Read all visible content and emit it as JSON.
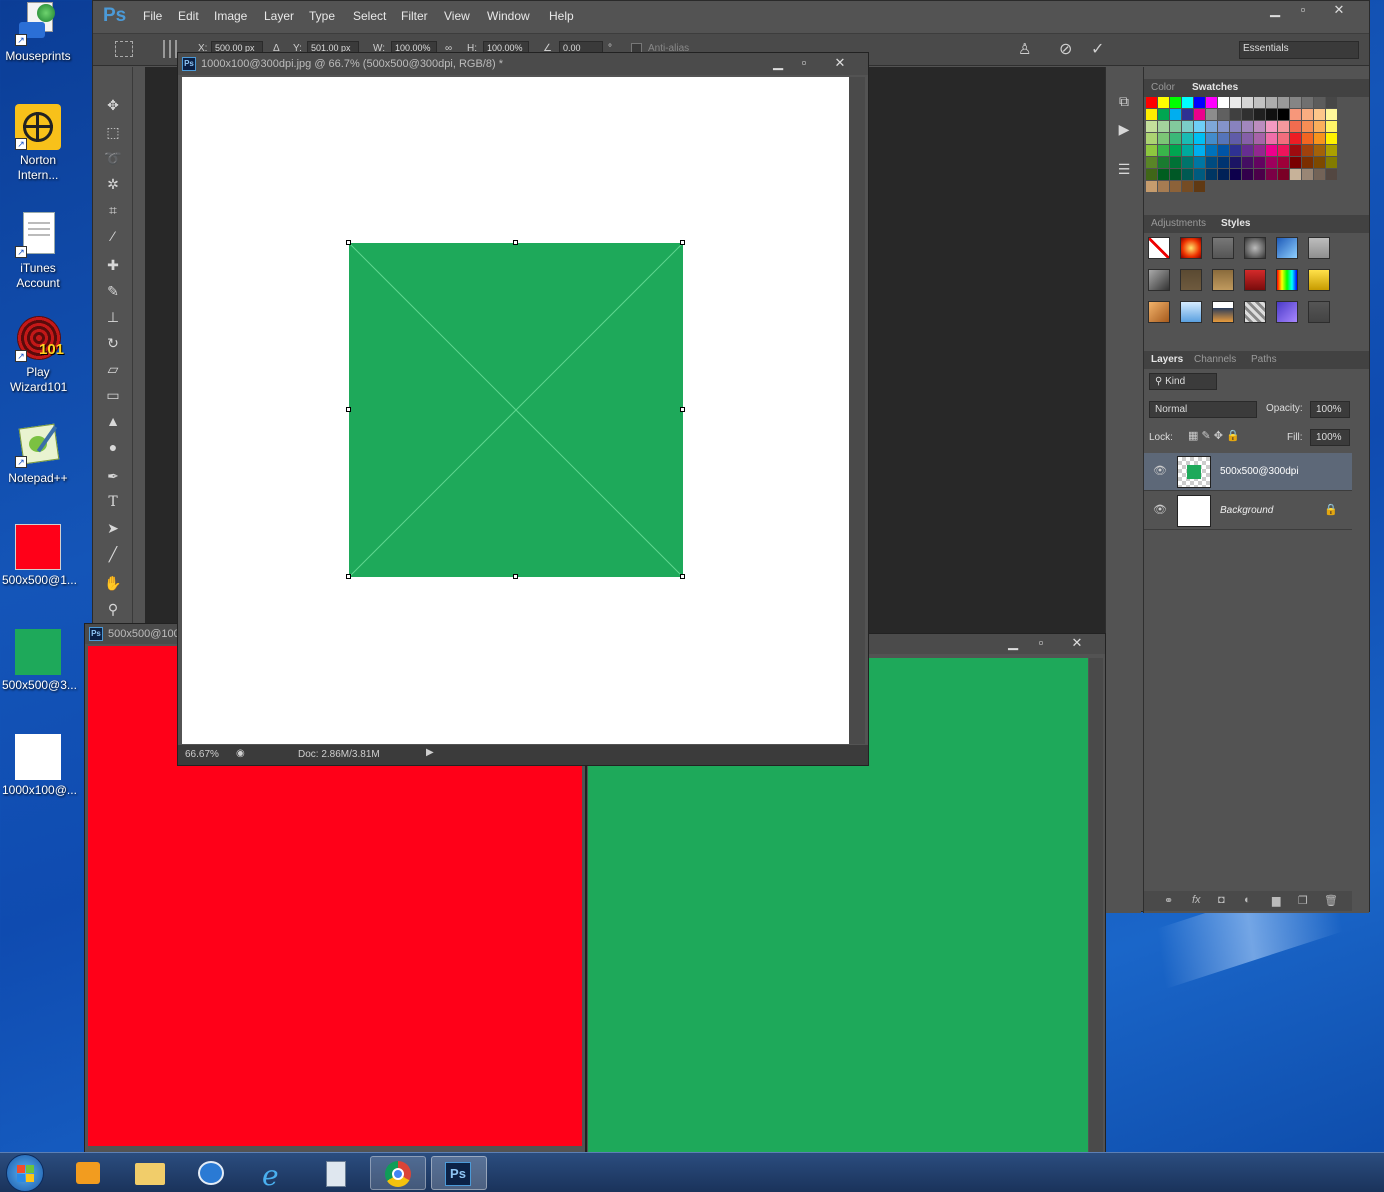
{
  "desktop": {
    "icons": [
      {
        "label": "Mouseprints"
      },
      {
        "label": "Norton Intern..."
      },
      {
        "label": "iTunes Account"
      },
      {
        "label": "Play Wizard101"
      },
      {
        "label": "Notepad++"
      },
      {
        "label": "500x500@1..."
      },
      {
        "label": "500x500@3..."
      },
      {
        "label": "1000x100@..."
      }
    ]
  },
  "photoshop": {
    "logo": "Ps",
    "menu": [
      "File",
      "Edit",
      "Image",
      "Layer",
      "Type",
      "Select",
      "Filter",
      "View",
      "Window",
      "Help"
    ],
    "options": {
      "x_label": "X:",
      "x_value": "500.00 px",
      "y_label": "Y:",
      "y_value": "501.00 px",
      "w_label": "W:",
      "w_value": "100.00%",
      "h_label": "H:",
      "h_value": "100.00%",
      "angle_value": "0.00",
      "angle_unit": "°",
      "antialias_label": "Anti-alias",
      "workspace": "Essentials"
    },
    "document": {
      "title": "1000x100@300dpi.jpg @ 66.7% (500x500@300dpi, RGB/8) *",
      "zoom": "66.67%",
      "doc_info": "Doc: 2.86M/3.81M",
      "square_color": "#1ea95a"
    },
    "red_window": {
      "title": "500x500@100",
      "color": "#ff0018"
    },
    "green_window": {
      "color": "#1ea95a"
    },
    "panels": {
      "color_tabs": [
        "Color",
        "Swatches"
      ],
      "style_tabs": [
        "Adjustments",
        "Styles"
      ],
      "layer_tabs": [
        "Layers",
        "Channels",
        "Paths"
      ],
      "kind_label": "Kind",
      "blend_mode": "Normal",
      "opacity_label": "Opacity:",
      "opacity_value": "100%",
      "lock_label": "Lock:",
      "fill_label": "Fill:",
      "fill_value": "100%",
      "layers": [
        {
          "name": "500x500@300dpi",
          "selected": true
        },
        {
          "name": "Background",
          "selected": false
        }
      ]
    }
  }
}
